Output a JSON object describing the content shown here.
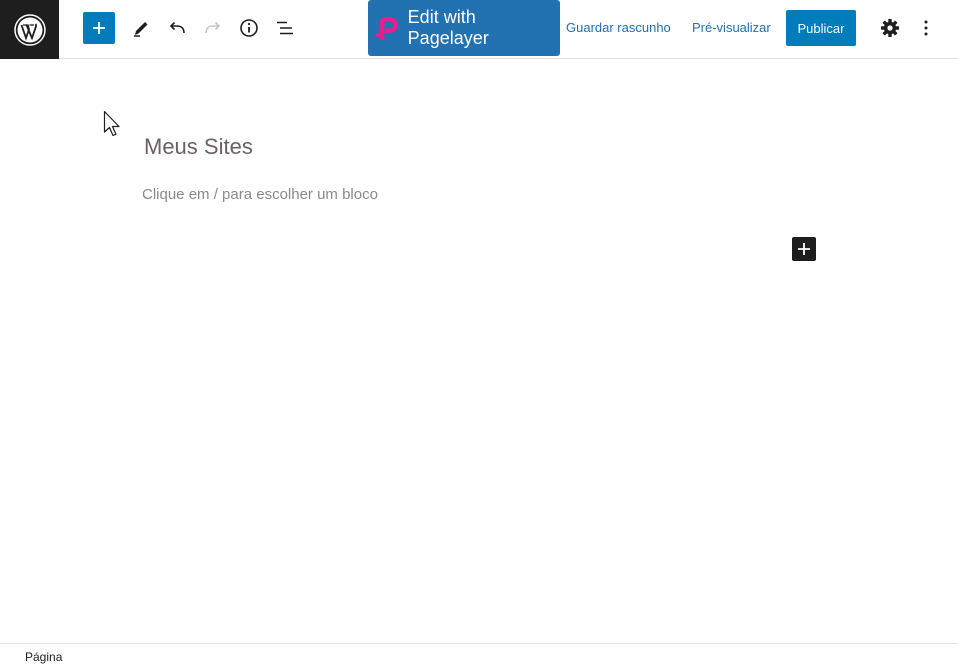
{
  "toolbar": {
    "logo_icon": "wordpress-logo",
    "inserter_icon": "plus-icon",
    "tools_icon": "pencil-icon",
    "undo_icon": "undo-icon",
    "redo_icon": "redo-icon",
    "details_icon": "info-icon",
    "list_view_icon": "list-view-icon",
    "pagelayer_label": "Edit with Pagelayer",
    "save_draft_label": "Guardar rascunho",
    "preview_label": "Pré-visualizar",
    "publish_label": "Publicar",
    "settings_icon": "gear-icon",
    "options_icon": "more-vertical-icon",
    "accent_color": "#007cba",
    "pagelayer_brand_color": "#e91e8c"
  },
  "editor": {
    "title": "Meus Sites",
    "placeholder": "Clique em / para escolher um bloco",
    "add_block_icon": "plus-icon"
  },
  "footer": {
    "breadcrumb": "Página"
  }
}
